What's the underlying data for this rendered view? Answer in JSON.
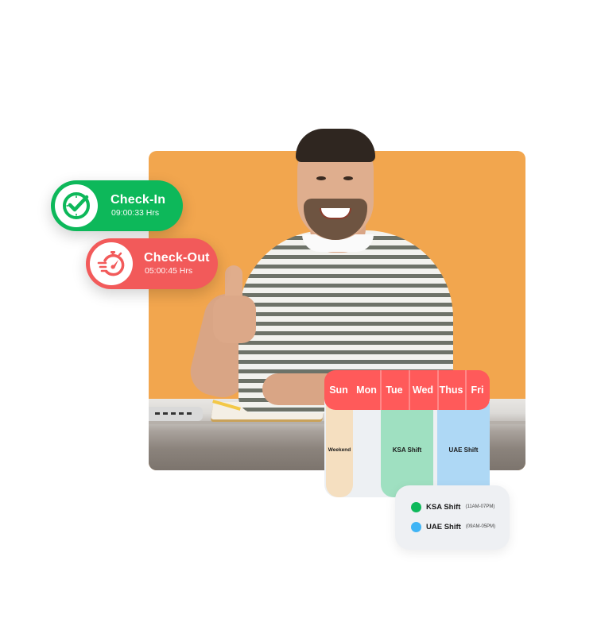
{
  "colors": {
    "photo_background": "#F2A64E",
    "check_in": "#0DB85A",
    "check_out": "#F25A5A",
    "calendar_header": "#FF5A5A",
    "weekend": "#F5DFC0",
    "off_day": "#EDF0F3",
    "ksa_shift": "#9FE0C1",
    "uae_shift": "#AED8F5",
    "legend_ksa_dot": "#0DB85A",
    "legend_uae_dot": "#3FB4F5"
  },
  "check_in": {
    "icon": "clock-check-icon",
    "title": "Check-In",
    "duration": "09:00:33 Hrs"
  },
  "check_out": {
    "icon": "stopwatch-fast-icon",
    "title": "Check-Out",
    "duration": "05:00:45 Hrs"
  },
  "calendar": {
    "days": [
      "Sun",
      "Mon",
      "Tue",
      "Wed",
      "Thus",
      "Fri"
    ],
    "blocks": {
      "weekend": "Weekend",
      "ksa": "KSA Shift",
      "uae": "UAE Shift"
    }
  },
  "legend": {
    "items": [
      {
        "name": "KSA Shift",
        "time": "(11AM-07PM)"
      },
      {
        "name": "UAE Shift",
        "time": "(09AM-05PM)"
      }
    ]
  },
  "photo": {
    "description": "Smiling man in striped t-shirt giving thumbs up at desk"
  }
}
